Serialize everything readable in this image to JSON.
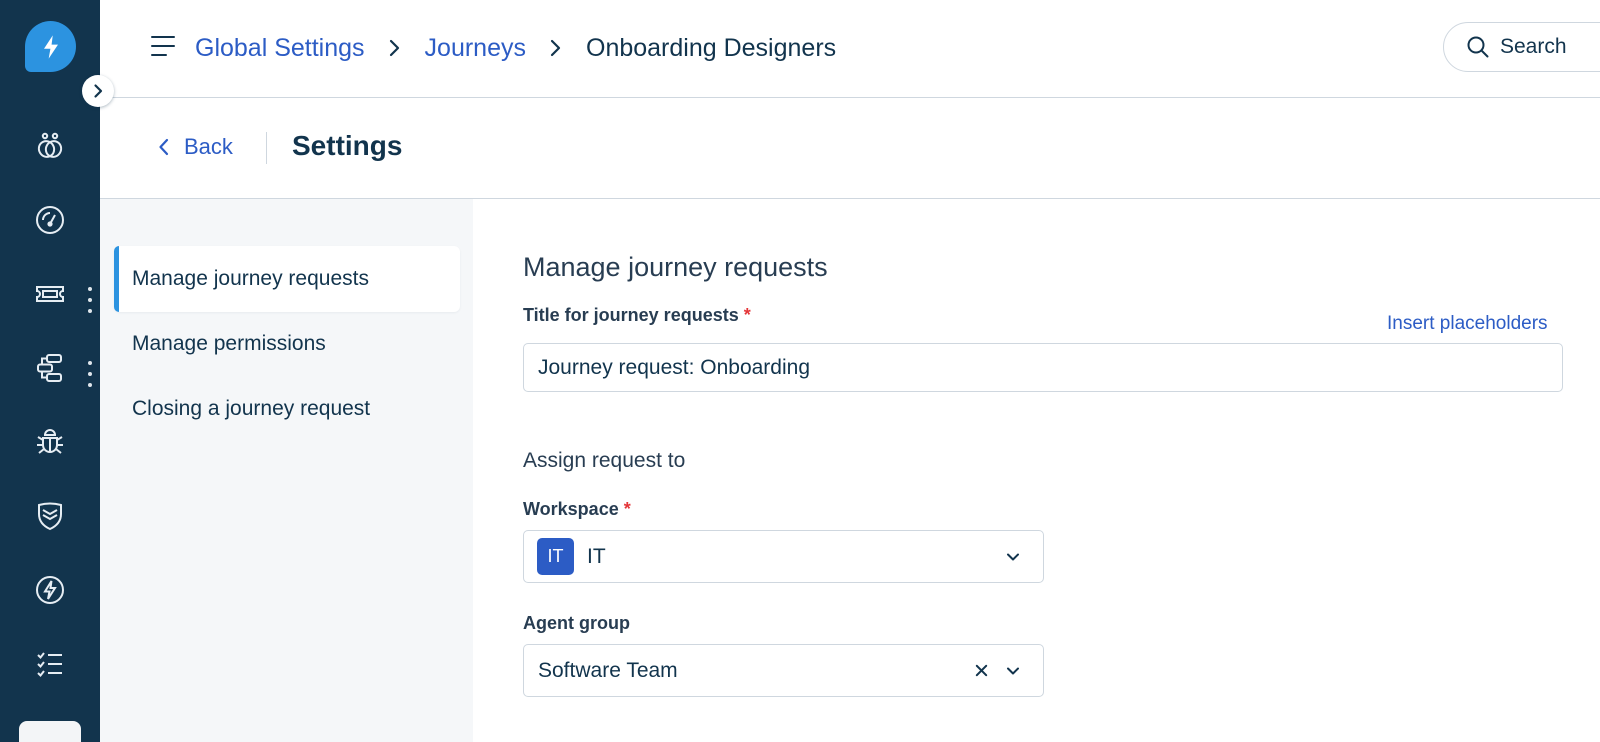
{
  "header": {
    "breadcrumb": [
      "Global Settings",
      "Journeys",
      "Onboarding Designers"
    ],
    "search_label": "Search"
  },
  "subheader": {
    "back_label": "Back",
    "title": "Settings"
  },
  "settings_nav": {
    "items": [
      {
        "label": "Manage journey requests",
        "active": true
      },
      {
        "label": "Manage permissions",
        "active": false
      },
      {
        "label": "Closing a journey request",
        "active": false
      }
    ]
  },
  "main": {
    "section_title": "Manage journey requests",
    "title_field": {
      "label": "Title for journey requests",
      "required_mark": "*",
      "value": "Journey request: Onboarding",
      "insert_link": "Insert placeholders"
    },
    "assign_heading": "Assign request to",
    "workspace": {
      "label": "Workspace",
      "required_mark": "*",
      "badge": "IT",
      "value": "IT"
    },
    "agent_group": {
      "label": "Agent group",
      "value": "Software Team"
    }
  },
  "theme": {
    "rail_bg": "#12344d",
    "link_color": "#2c5cc5",
    "accent": "#2c93e0",
    "required_color": "#e43538"
  },
  "rail_icons": [
    "logo-icon",
    "contacts-icon",
    "dashboard-icon",
    "tickets-icon",
    "workflow-icon",
    "bug-icon",
    "shield-icon",
    "bolt-icon",
    "checklist-icon"
  ]
}
